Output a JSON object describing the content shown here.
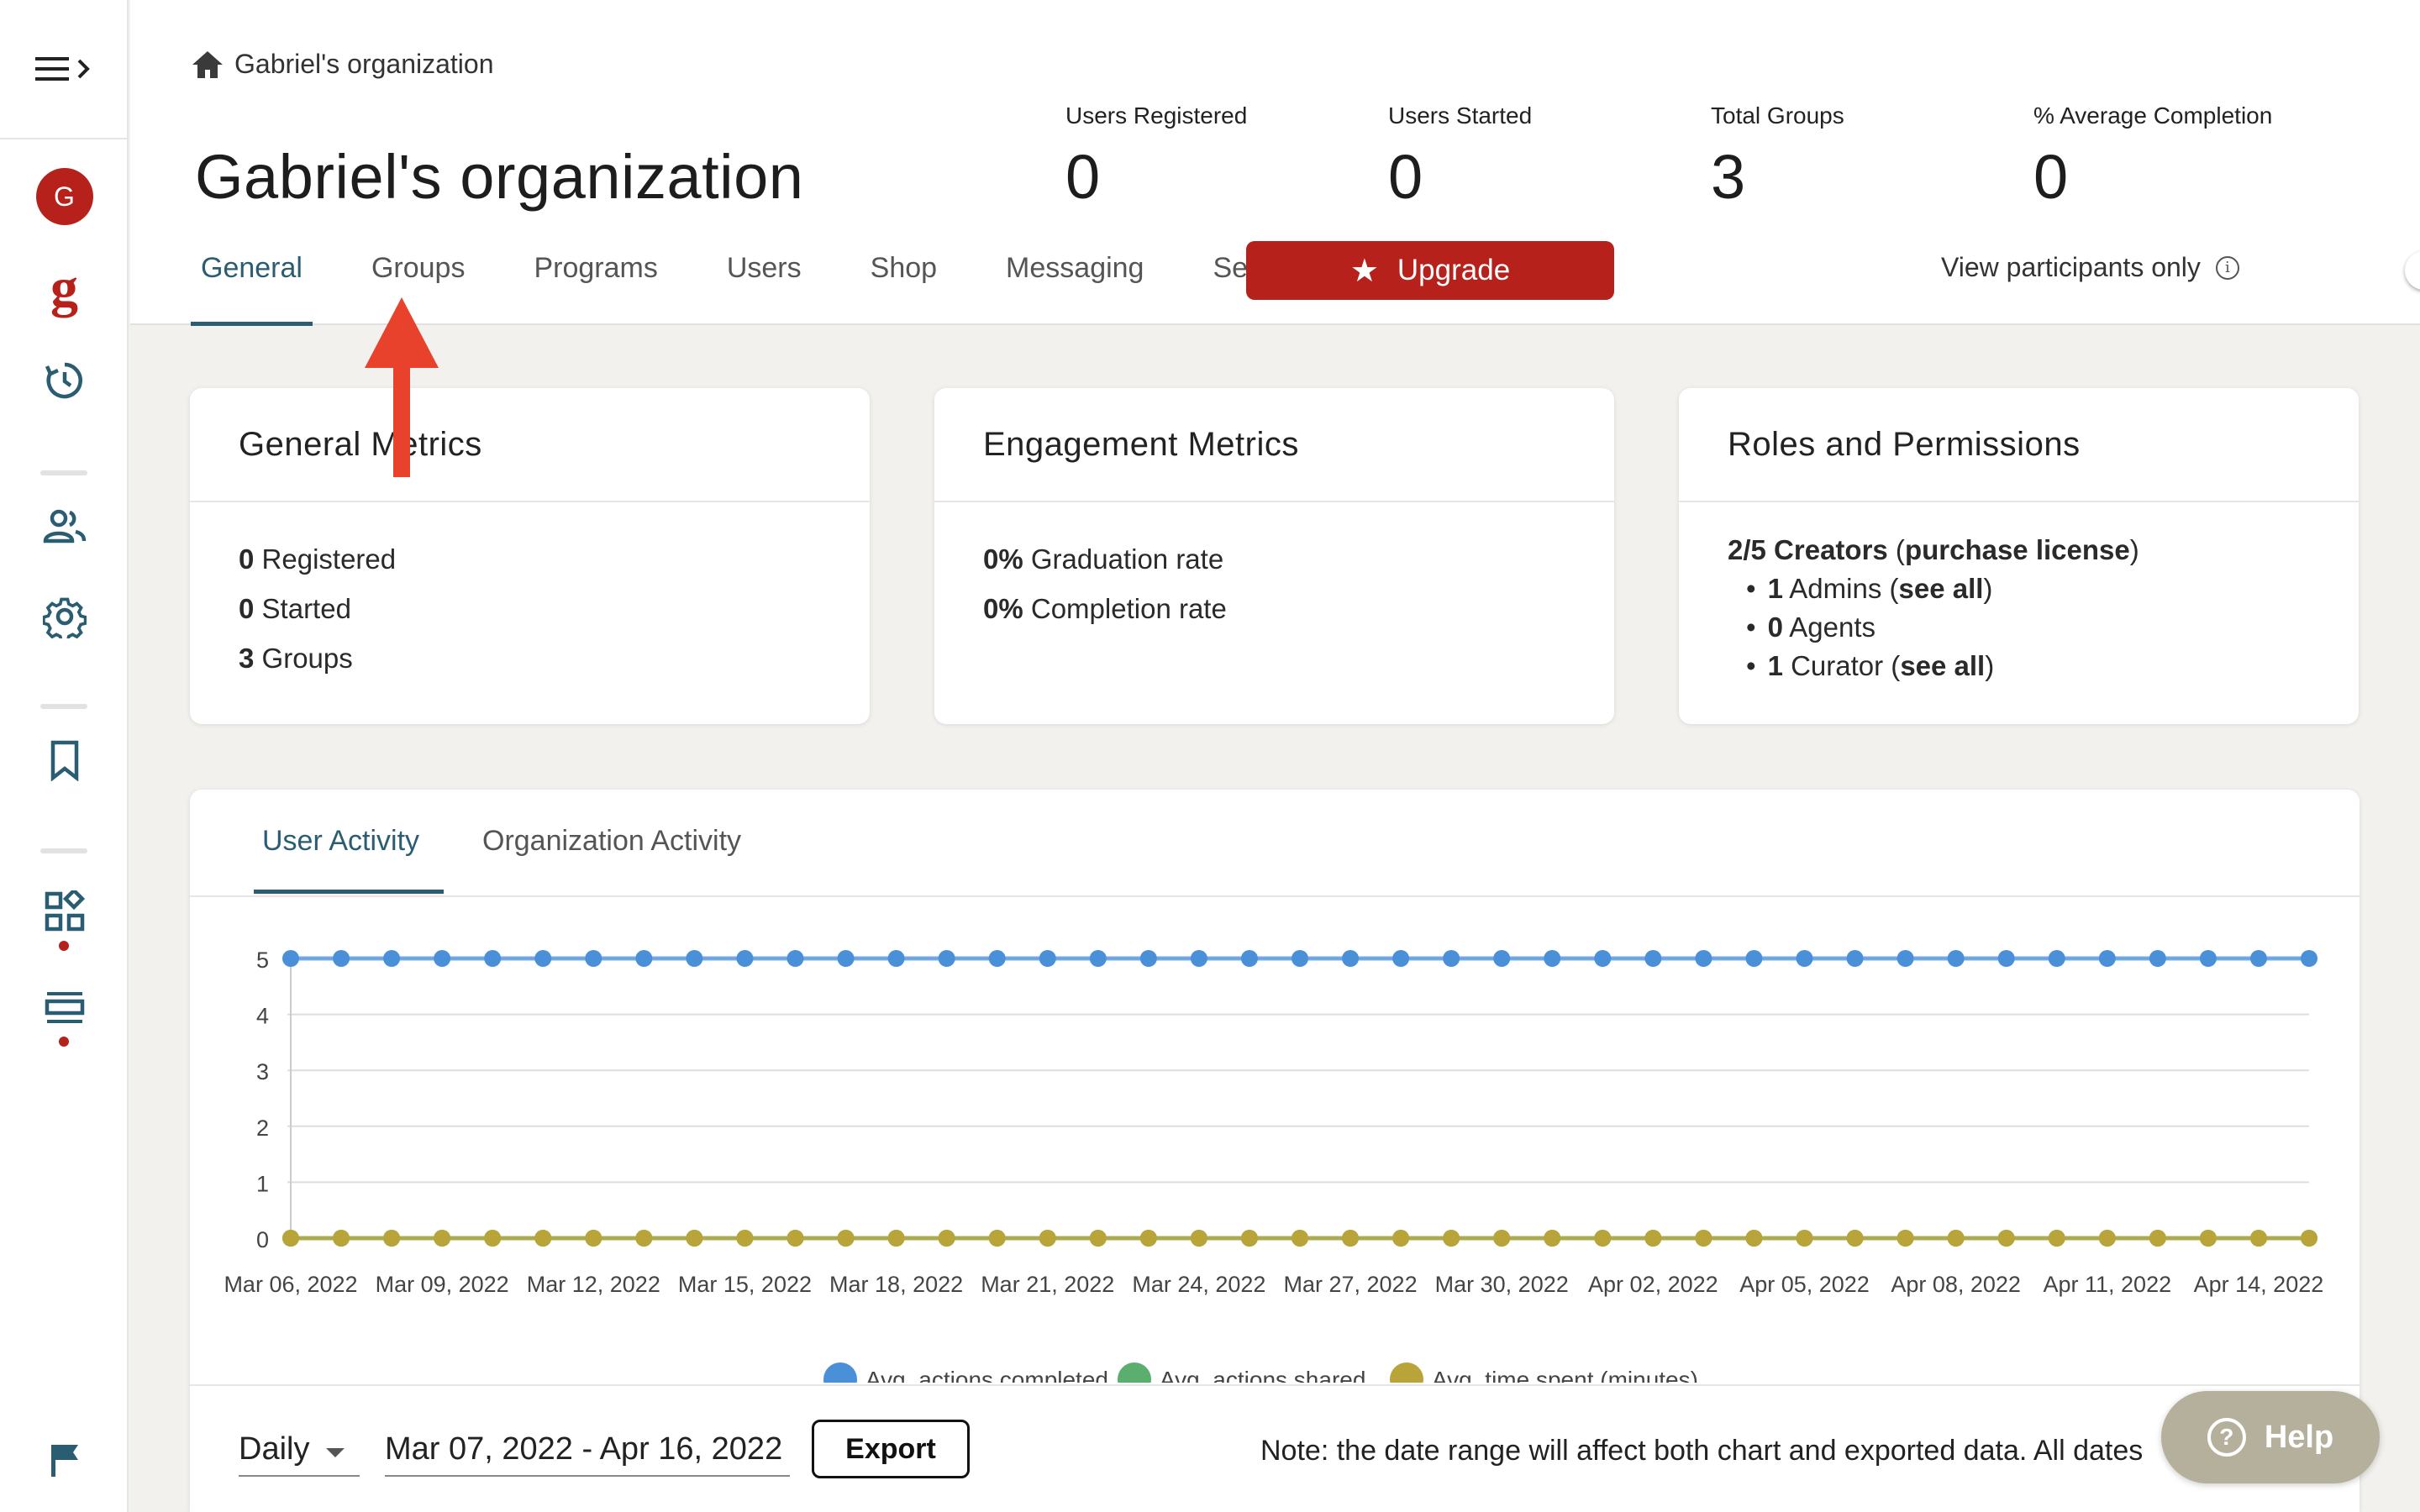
{
  "sidebar": {
    "menu_icon": "hamburger-expand-icon",
    "avatar_letter": "G",
    "logo_letter": "g",
    "icons": [
      "history-icon",
      "users-icon",
      "gear-icon",
      "bookmark-icon",
      "widgets-icon",
      "list-icon",
      "flag-icon"
    ],
    "accent_color": "#b6221b"
  },
  "header": {
    "breadcrumb": "Gabriel's organization",
    "title": "Gabriel's organization",
    "stats": [
      {
        "label": "Users Registered",
        "value": "0"
      },
      {
        "label": "Users Started",
        "value": "0"
      },
      {
        "label": "Total Groups",
        "value": "3"
      },
      {
        "label": "% Average Completion",
        "value": "0"
      }
    ],
    "tabs": [
      "General",
      "Groups",
      "Programs",
      "Users",
      "Shop",
      "Messaging",
      "Settings"
    ],
    "active_tab": "General",
    "upgrade_label": "Upgrade",
    "view_participants_label": "View participants only",
    "view_participants_on": false,
    "tab_color": "#2a5d72"
  },
  "cards": {
    "general": {
      "title": "General Metrics",
      "rows": [
        {
          "num": "0",
          "text": "Registered"
        },
        {
          "num": "0",
          "text": "Started"
        },
        {
          "num": "3",
          "text": "Groups"
        }
      ]
    },
    "engagement": {
      "title": "Engagement Metrics",
      "rows": [
        {
          "num": "0%",
          "text": "Graduation rate"
        },
        {
          "num": "0%",
          "text": "Completion rate"
        }
      ]
    },
    "roles": {
      "title": "Roles and Permissions",
      "creators": "2/5 Creators",
      "purchase_link": "purchase license",
      "admins_num": "1",
      "admins_text": "Admins",
      "agents_num": "0",
      "agents_text": "Agents",
      "curator_num": "1",
      "curator_text": "Curator",
      "see_all": "see all"
    }
  },
  "activity": {
    "tabs": [
      "User Activity",
      "Organization Activity"
    ],
    "active_tab": "User Activity",
    "period": "Daily",
    "date_range": "Mar 07, 2022 - Apr 16, 2022",
    "export_label": "Export",
    "note": "Note: the date range will affect both chart and exported data. All dates"
  },
  "chart_data": {
    "type": "line",
    "x": [
      "Mar 06, 2022",
      "Mar 07, 2022",
      "Mar 08, 2022",
      "Mar 09, 2022",
      "Mar 10, 2022",
      "Mar 11, 2022",
      "Mar 12, 2022",
      "Mar 13, 2022",
      "Mar 14, 2022",
      "Mar 15, 2022",
      "Mar 16, 2022",
      "Mar 17, 2022",
      "Mar 18, 2022",
      "Mar 19, 2022",
      "Mar 20, 2022",
      "Mar 21, 2022",
      "Mar 22, 2022",
      "Mar 23, 2022",
      "Mar 24, 2022",
      "Mar 25, 2022",
      "Mar 26, 2022",
      "Mar 27, 2022",
      "Mar 28, 2022",
      "Mar 29, 2022",
      "Mar 30, 2022",
      "Mar 31, 2022",
      "Apr 01, 2022",
      "Apr 02, 2022",
      "Apr 03, 2022",
      "Apr 04, 2022",
      "Apr 05, 2022",
      "Apr 06, 2022",
      "Apr 07, 2022",
      "Apr 08, 2022",
      "Apr 09, 2022",
      "Apr 10, 2022",
      "Apr 11, 2022",
      "Apr 12, 2022",
      "Apr 13, 2022",
      "Apr 14, 2022",
      "Apr 15, 2022"
    ],
    "x_tick_labels": [
      "Mar 06, 2022",
      "Mar 09, 2022",
      "Mar 12, 2022",
      "Mar 15, 2022",
      "Mar 18, 2022",
      "Mar 21, 2022",
      "Mar 24, 2022",
      "Mar 27, 2022",
      "Mar 30, 2022",
      "Apr 02, 2022",
      "Apr 05, 2022",
      "Apr 08, 2022",
      "Apr 11, 2022",
      "Apr 14, 2022"
    ],
    "y_ticks": [
      0,
      1,
      2,
      3,
      4,
      5
    ],
    "ylim": [
      0,
      5
    ],
    "grid": true,
    "legend_position": "bottom",
    "series": [
      {
        "name": "Avg. actions completed",
        "color": "#4a90d9",
        "values": [
          5,
          5,
          5,
          5,
          5,
          5,
          5,
          5,
          5,
          5,
          5,
          5,
          5,
          5,
          5,
          5,
          5,
          5,
          5,
          5,
          5,
          5,
          5,
          5,
          5,
          5,
          5,
          5,
          5,
          5,
          5,
          5,
          5,
          5,
          5,
          5,
          5,
          5,
          5,
          5,
          5
        ]
      },
      {
        "name": "Avg. actions shared",
        "color": "#5aae6e",
        "values": [
          0,
          0,
          0,
          0,
          0,
          0,
          0,
          0,
          0,
          0,
          0,
          0,
          0,
          0,
          0,
          0,
          0,
          0,
          0,
          0,
          0,
          0,
          0,
          0,
          0,
          0,
          0,
          0,
          0,
          0,
          0,
          0,
          0,
          0,
          0,
          0,
          0,
          0,
          0,
          0,
          0
        ]
      },
      {
        "name": "Avg. time spent (minutes)",
        "color": "#b9a43a",
        "values": [
          0,
          0,
          0,
          0,
          0,
          0,
          0,
          0,
          0,
          0,
          0,
          0,
          0,
          0,
          0,
          0,
          0,
          0,
          0,
          0,
          0,
          0,
          0,
          0,
          0,
          0,
          0,
          0,
          0,
          0,
          0,
          0,
          0,
          0,
          0,
          0,
          0,
          0,
          0,
          0,
          0
        ]
      }
    ]
  },
  "help": {
    "label": "Help"
  },
  "annotation": {
    "arrow_color": "#e8412c"
  }
}
